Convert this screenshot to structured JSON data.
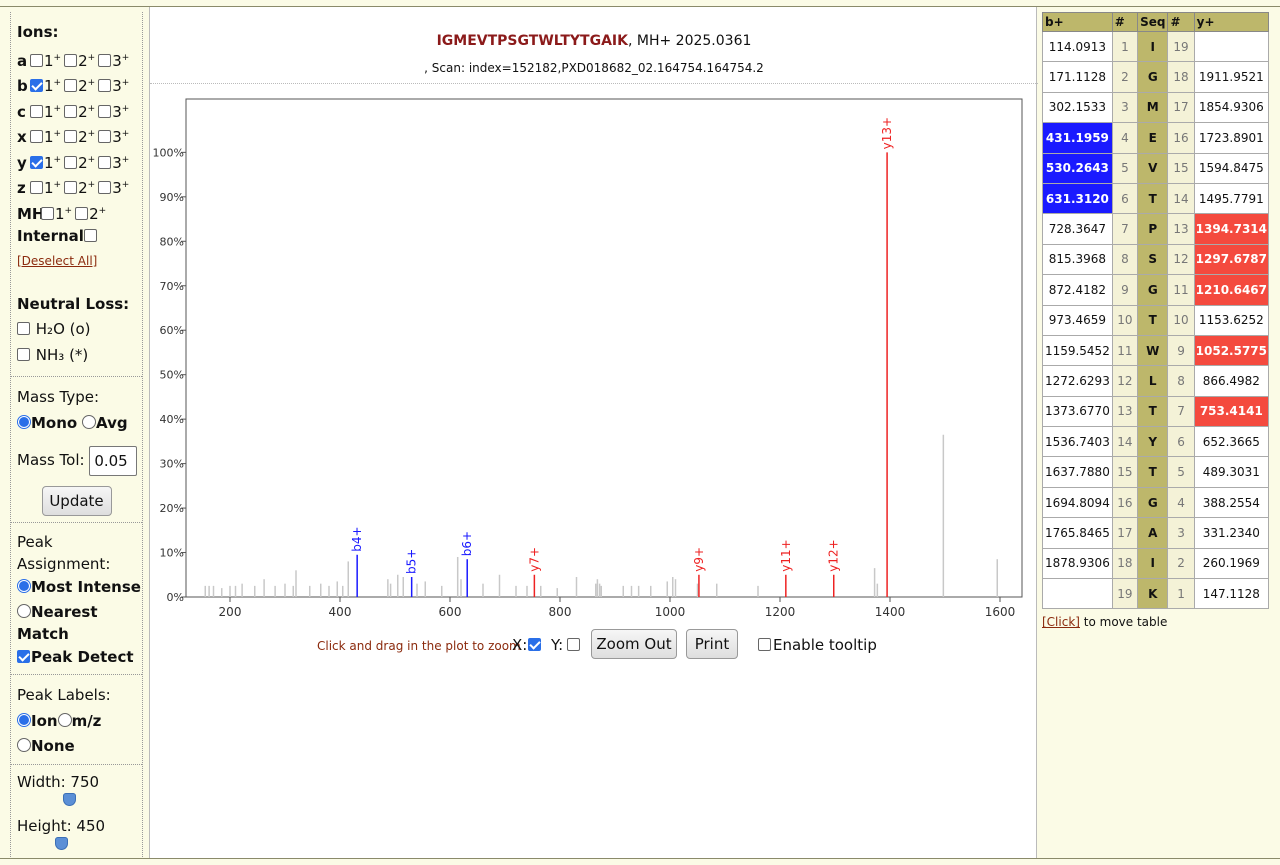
{
  "sidebar": {
    "ions_title": "Ions:",
    "ion_rows": [
      {
        "letter": "a",
        "charges": [
          "1",
          "2",
          "3"
        ],
        "checked": [
          false,
          false,
          false
        ]
      },
      {
        "letter": "b",
        "charges": [
          "1",
          "2",
          "3"
        ],
        "checked": [
          true,
          false,
          false
        ]
      },
      {
        "letter": "c",
        "charges": [
          "1",
          "2",
          "3"
        ],
        "checked": [
          false,
          false,
          false
        ]
      },
      {
        "letter": "x",
        "charges": [
          "1",
          "2",
          "3"
        ],
        "checked": [
          false,
          false,
          false
        ]
      },
      {
        "letter": "y",
        "charges": [
          "1",
          "2",
          "3"
        ],
        "checked": [
          true,
          false,
          false
        ]
      },
      {
        "letter": "z",
        "charges": [
          "1",
          "2",
          "3"
        ],
        "checked": [
          false,
          false,
          false
        ]
      },
      {
        "letter": "MH",
        "charges": [
          "1",
          "2"
        ],
        "checked": [
          false,
          false
        ]
      }
    ],
    "internal_label": "Internal",
    "deselect_all": "[Deselect All]",
    "neutral_loss_title": "Neutral Loss:",
    "h2o_label": "H₂O (o)",
    "nh3_label": "NH₃ (*)",
    "mass_type_title": "Mass Type:",
    "mono_label": "Mono",
    "avg_label": "Avg",
    "mass_tol_label": "Mass Tol:",
    "mass_tol_value": "0.05",
    "update_button": "Update",
    "peak_assign_title": "Peak Assignment:",
    "most_intense_label": "Most Intense",
    "nearest_match_label": "Nearest Match",
    "peak_detect_label": "Peak Detect",
    "peak_labels_title": "Peak Labels:",
    "ion_label": "Ion",
    "mz_label": "m/z",
    "none_label": "None",
    "width_label": "Width: 750",
    "height_label": "Height: 450"
  },
  "header": {
    "peptide": "IGMEVTPSGTWLTYTGAIK",
    "mh": ", MH+ 2025.0361",
    "scan": ", Scan: index=152182,PXD018682_02.164754.164754.2"
  },
  "controls": {
    "zoom_hint": "Click and drag in the plot to zoom",
    "x_label": "X:",
    "y_label": "Y:",
    "zoom_out": "Zoom Out",
    "print": "Print",
    "tooltip_label": "Enable tooltip"
  },
  "colors": {
    "b_ion": "#1a1aff",
    "y_ion": "#ee2222",
    "unassigned": "#c8c8c8"
  },
  "chart_data": {
    "type": "bar",
    "xlabel": "",
    "ylabel": "",
    "xlim": [
      120,
      1640
    ],
    "ylim": [
      0,
      112
    ],
    "x_ticks": [
      "200",
      "400",
      "600",
      "800",
      "1000",
      "1200",
      "1400",
      "1600"
    ],
    "y_ticks": [
      "0%",
      "10%",
      "20%",
      "30%",
      "40%",
      "50%",
      "60%",
      "70%",
      "80%",
      "90%",
      "100%"
    ],
    "labeled_peaks": [
      {
        "label": "b4+",
        "mz": 431.2,
        "intensity": 9.5,
        "ion": "b"
      },
      {
        "label": "b5+",
        "mz": 530.3,
        "intensity": 4.5,
        "ion": "b"
      },
      {
        "label": "b6+",
        "mz": 631.3,
        "intensity": 8.5,
        "ion": "b"
      },
      {
        "label": "y7+",
        "mz": 753.4,
        "intensity": 5,
        "ion": "y"
      },
      {
        "label": "y9+",
        "mz": 1052.6,
        "intensity": 5,
        "ion": "y"
      },
      {
        "label": "y11+",
        "mz": 1210.6,
        "intensity": 5,
        "ion": "y"
      },
      {
        "label": "y12+",
        "mz": 1297.7,
        "intensity": 5,
        "ion": "y"
      },
      {
        "label": "y13+",
        "mz": 1394.7,
        "intensity": 100,
        "ion": "y"
      }
    ],
    "other_peaks": [
      [
        155,
        2.5
      ],
      [
        162,
        2.5
      ],
      [
        170,
        2.5
      ],
      [
        185,
        2
      ],
      [
        200,
        2.5
      ],
      [
        210,
        2.5
      ],
      [
        222,
        3
      ],
      [
        245,
        2.5
      ],
      [
        262,
        4
      ],
      [
        282,
        2.5
      ],
      [
        300,
        3
      ],
      [
        315,
        2.5
      ],
      [
        320,
        6
      ],
      [
        345,
        2.5
      ],
      [
        365,
        3
      ],
      [
        380,
        2.5
      ],
      [
        395,
        3.5
      ],
      [
        405,
        2.5
      ],
      [
        415,
        8
      ],
      [
        487,
        4
      ],
      [
        492,
        3
      ],
      [
        505,
        5
      ],
      [
        515,
        4.5
      ],
      [
        540,
        3
      ],
      [
        555,
        3.5
      ],
      [
        585,
        2.5
      ],
      [
        614,
        9
      ],
      [
        620,
        4
      ],
      [
        660,
        3
      ],
      [
        690,
        5
      ],
      [
        720,
        2.5
      ],
      [
        740,
        2.5
      ],
      [
        765,
        2.5
      ],
      [
        795,
        2
      ],
      [
        830,
        4.5
      ],
      [
        865,
        3
      ],
      [
        868,
        4
      ],
      [
        872,
        3
      ],
      [
        875,
        2.5
      ],
      [
        915,
        2.5
      ],
      [
        930,
        2.5
      ],
      [
        943,
        2.5
      ],
      [
        965,
        2.5
      ],
      [
        995,
        3.5
      ],
      [
        1005,
        4.5
      ],
      [
        1010,
        4
      ],
      [
        1050,
        3
      ],
      [
        1085,
        3
      ],
      [
        1160,
        2.5
      ],
      [
        1372,
        6.5
      ],
      [
        1377,
        3
      ],
      [
        1497,
        36.5
      ],
      [
        1595,
        8.5
      ]
    ]
  },
  "fragment_table": {
    "headers": [
      "b+",
      "#",
      "Seq",
      "#",
      "y+"
    ],
    "rows": [
      {
        "b": "114.0913",
        "n": "1",
        "aa": "I",
        "m": "19",
        "y": "",
        "hb": false,
        "hy": false
      },
      {
        "b": "171.1128",
        "n": "2",
        "aa": "G",
        "m": "18",
        "y": "1911.9521",
        "hb": false,
        "hy": false
      },
      {
        "b": "302.1533",
        "n": "3",
        "aa": "M",
        "m": "17",
        "y": "1854.9306",
        "hb": false,
        "hy": false
      },
      {
        "b": "431.1959",
        "n": "4",
        "aa": "E",
        "m": "16",
        "y": "1723.8901",
        "hb": true,
        "hy": false
      },
      {
        "b": "530.2643",
        "n": "5",
        "aa": "V",
        "m": "15",
        "y": "1594.8475",
        "hb": true,
        "hy": false
      },
      {
        "b": "631.3120",
        "n": "6",
        "aa": "T",
        "m": "14",
        "y": "1495.7791",
        "hb": true,
        "hy": false
      },
      {
        "b": "728.3647",
        "n": "7",
        "aa": "P",
        "m": "13",
        "y": "1394.7314",
        "hb": false,
        "hy": true
      },
      {
        "b": "815.3968",
        "n": "8",
        "aa": "S",
        "m": "12",
        "y": "1297.6787",
        "hb": false,
        "hy": true
      },
      {
        "b": "872.4182",
        "n": "9",
        "aa": "G",
        "m": "11",
        "y": "1210.6467",
        "hb": false,
        "hy": true
      },
      {
        "b": "973.4659",
        "n": "10",
        "aa": "T",
        "m": "10",
        "y": "1153.6252",
        "hb": false,
        "hy": false
      },
      {
        "b": "1159.5452",
        "n": "11",
        "aa": "W",
        "m": "9",
        "y": "1052.5775",
        "hb": false,
        "hy": true
      },
      {
        "b": "1272.6293",
        "n": "12",
        "aa": "L",
        "m": "8",
        "y": "866.4982",
        "hb": false,
        "hy": false
      },
      {
        "b": "1373.6770",
        "n": "13",
        "aa": "T",
        "m": "7",
        "y": "753.4141",
        "hb": false,
        "hy": true
      },
      {
        "b": "1536.7403",
        "n": "14",
        "aa": "Y",
        "m": "6",
        "y": "652.3665",
        "hb": false,
        "hy": false
      },
      {
        "b": "1637.7880",
        "n": "15",
        "aa": "T",
        "m": "5",
        "y": "489.3031",
        "hb": false,
        "hy": false
      },
      {
        "b": "1694.8094",
        "n": "16",
        "aa": "G",
        "m": "4",
        "y": "388.2554",
        "hb": false,
        "hy": false
      },
      {
        "b": "1765.8465",
        "n": "17",
        "aa": "A",
        "m": "3",
        "y": "331.2340",
        "hb": false,
        "hy": false
      },
      {
        "b": "1878.9306",
        "n": "18",
        "aa": "I",
        "m": "2",
        "y": "260.1969",
        "hb": false,
        "hy": false
      },
      {
        "b": "",
        "n": "19",
        "aa": "K",
        "m": "1",
        "y": "147.1128",
        "hb": false,
        "hy": false
      }
    ],
    "move_link": "[Click]",
    "move_text": " to move table"
  }
}
